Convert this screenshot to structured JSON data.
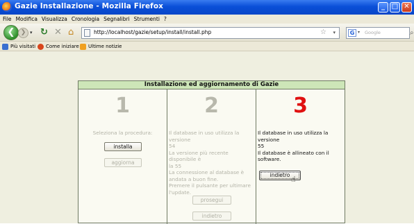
{
  "window": {
    "title": "Gazie Installazione - Mozilla Firefox"
  },
  "menu": [
    "File",
    "Modifica",
    "Visualizza",
    "Cronologia",
    "Segnalibri",
    "Strumenti",
    "?"
  ],
  "address": {
    "url": "http://localhost/gazie/setup/install/install.php"
  },
  "search": {
    "placeholder": "Google"
  },
  "bookmarks": [
    {
      "label": "Più visitati",
      "icon": "bar-chart-icon"
    },
    {
      "label": "Come iniziare",
      "icon": "firefox-icon"
    },
    {
      "label": "Ultime notizie",
      "icon": "rss-icon"
    }
  ],
  "panel": {
    "heading": "Installazione ed aggiornamento di Gazie",
    "step1": {
      "number": "1",
      "text": "Seleziona la procedura:",
      "install": "installa",
      "update": "aggiorna"
    },
    "step2": {
      "number": "2",
      "lines": [
        "Il database in uso utilizza la versione",
        "54",
        "La versione più recente disponibile è",
        "la 55",
        "La connessione al database è",
        "andata a buon fine.",
        "Premere il pulsante per ultimare",
        "l'update."
      ],
      "proceed": "prosegui",
      "back": "indietro"
    },
    "step3": {
      "number": "3",
      "lines": [
        "Il database in uso utilizza la versione",
        "55",
        "Il database è allineato con il",
        "software."
      ],
      "back": "indietro"
    }
  },
  "colors": {
    "titlebar": "#0a4fd8",
    "header_bg": "#cde6b8",
    "active_step": "#e01010",
    "page_bg": "#efefe0"
  }
}
